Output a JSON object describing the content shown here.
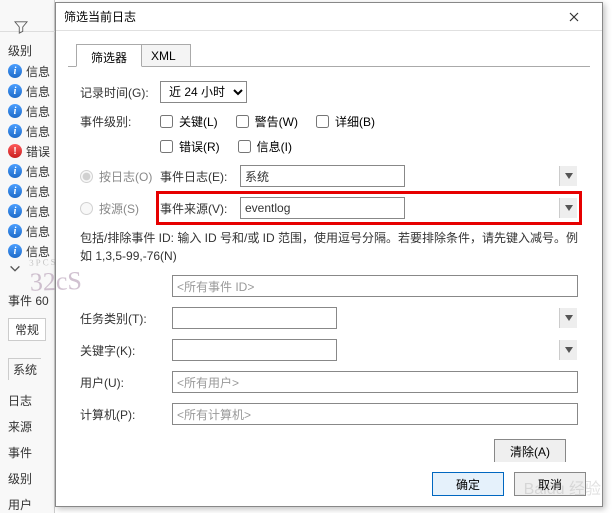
{
  "bg": {
    "level_header": "级别",
    "info_label": "信息",
    "error_label": "错误",
    "event_header": "事件 60",
    "general_tab": "常规",
    "sys_row": "系统",
    "labels": {
      "log": "日志",
      "source": "来源",
      "eventid": "事件",
      "level": "级别",
      "user": "用户"
    }
  },
  "dialog": {
    "title": "筛选当前日志",
    "tabs": {
      "filter": "筛选器",
      "xml": "XML"
    },
    "time": {
      "label": "记录时间(G):",
      "value": "近 24 小时"
    },
    "level": {
      "label": "事件级别:",
      "critical": "关键(L)",
      "warning": "警告(W)",
      "verbose": "详细(B)",
      "error": "错误(R)",
      "info": "信息(I)"
    },
    "bylog": {
      "radio": "按日志(O)",
      "label": "事件日志(E):",
      "value": "系统"
    },
    "bysource": {
      "radio": "按源(S)",
      "label": "事件来源(V):",
      "value": "eventlog"
    },
    "hint": "包括/排除事件 ID: 输入 ID 号和/或 ID 范围，使用逗号分隔。若要排除条件，请先键入减号。例如 1,3,5-99,-76(N)",
    "eventid_value": "<所有事件 ID>",
    "task": {
      "label": "任务类别(T):"
    },
    "keywords": {
      "label": "关键字(K):"
    },
    "user": {
      "label": "用户(U):",
      "value": "<所有用户>"
    },
    "computer": {
      "label": "计算机(P):",
      "value": "<所有计算机>"
    },
    "clear": "清除(A)",
    "ok": "确定",
    "cancel": "取消"
  }
}
